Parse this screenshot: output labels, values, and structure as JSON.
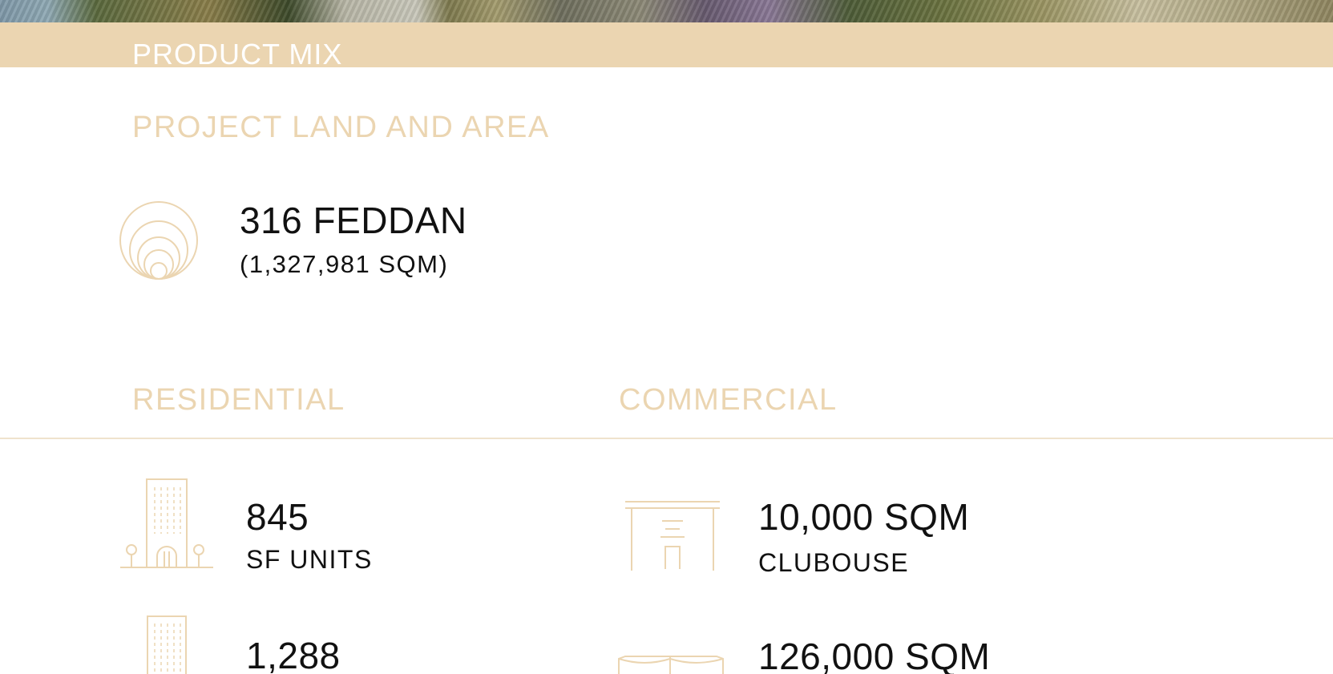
{
  "header": {
    "title": "PRODUCT MIX"
  },
  "land": {
    "heading": "PROJECT LAND AND AREA",
    "icon": "concentric-circles-icon",
    "value": "316 FEDDAN",
    "sub": "(1,327,981 SQM)"
  },
  "residential": {
    "heading": "RESIDENTIAL",
    "items": [
      {
        "icon": "building-with-trees-icon",
        "value": "845",
        "label": "SF UNITS"
      },
      {
        "icon": "tower-building-icon",
        "value": "1,288",
        "label": ""
      }
    ]
  },
  "commercial": {
    "heading": "COMMERCIAL",
    "items": [
      {
        "icon": "clubhouse-gate-icon",
        "value": "10,000 SQM",
        "label": "CLUBOUSE"
      },
      {
        "icon": "retail-building-icon",
        "value": "126,000 SQM",
        "label": ""
      }
    ]
  },
  "colors": {
    "accent": "#ebd5b1",
    "text": "#111111",
    "background": "#ffffff"
  }
}
